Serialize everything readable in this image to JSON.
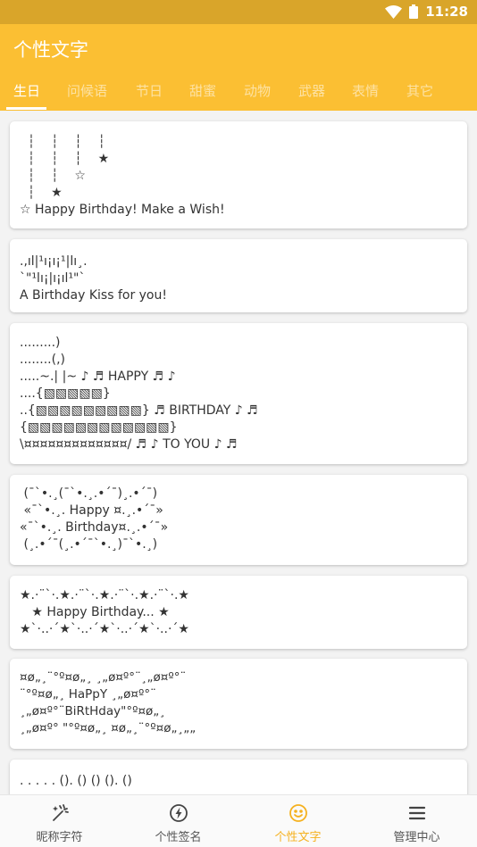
{
  "status": {
    "time": "11:28"
  },
  "app": {
    "title": "个性文字"
  },
  "tabs": [
    "生日",
    "问候语",
    "节日",
    "甜蜜",
    "动物",
    "武器",
    "表情",
    "其它"
  ],
  "cards": [
    "  ┆    ┆    ┆    ┆\n  ┆    ┆    ┆    ★\n  ┆    ┆    ☆\n  ┆    ★\n☆ Happy Birthday! Make a Wish!",
    ".,ıl|¹ı¡ı¡¹|lı¸.\n`\"¹lı¡|ı¡ıl¹\"`\nA Birthday Kiss for you!",
    ".........)\n........(,)\n.....~.| |~ ♪ ♬ HAPPY ♬ ♪\n....{▧▧▧▧▧}\n..{▧▧▧▧▧▧▧▧▧} ♬ BIRTHDAY ♪ ♬\n{▧▧▧▧▧▧▧▧▧▧▧▧}\n\\¤¤¤¤¤¤¤¤¤¤¤¤¤/ ♬ ♪ TO YOU ♪ ♬",
    " (¯`•.¸(¯`•.¸.•´¯)¸.•´¯)\n «¯`•.¸. Happy ¤.¸.•´¯»\n«¯`•.¸. Birthday¤.¸.•´¯»\n (¸.•´¯(¸.•´¯`•.¸)¯`•.¸)",
    "★.·¨`·.★.·¨`·.★.·¨`·.★.·¨`·.★\n   ★ Happy Birthday... ★\n★`·..·´★`·..·´★`·..·´★`·..·´★",
    "¤ø„¸¨°º¤ø„¸ ¸„ø¤º°¨¸„ø¤º°¨\n¨°º¤ø„¸ HaPpY ¸„ø¤º°¨\n¸„ø¤º°¨BiRtHday\"°º¤ø„¸\n¸„ø¤º° \"°º¤ø„¸ ¤ø„¸¨°º¤ø„¸„„",
    ". . . . . (). () () (). ()"
  ],
  "nav": [
    {
      "label": "昵称字符",
      "icon": "magic-wand-icon"
    },
    {
      "label": "个性签名",
      "icon": "lightning-icon"
    },
    {
      "label": "个性文字",
      "icon": "smiley-icon"
    },
    {
      "label": "管理中心",
      "icon": "menu-icon"
    }
  ],
  "colors": {
    "accent": "#fbbf33",
    "status_bar": "#d9a52a",
    "nav_active": "#f5b11f"
  }
}
